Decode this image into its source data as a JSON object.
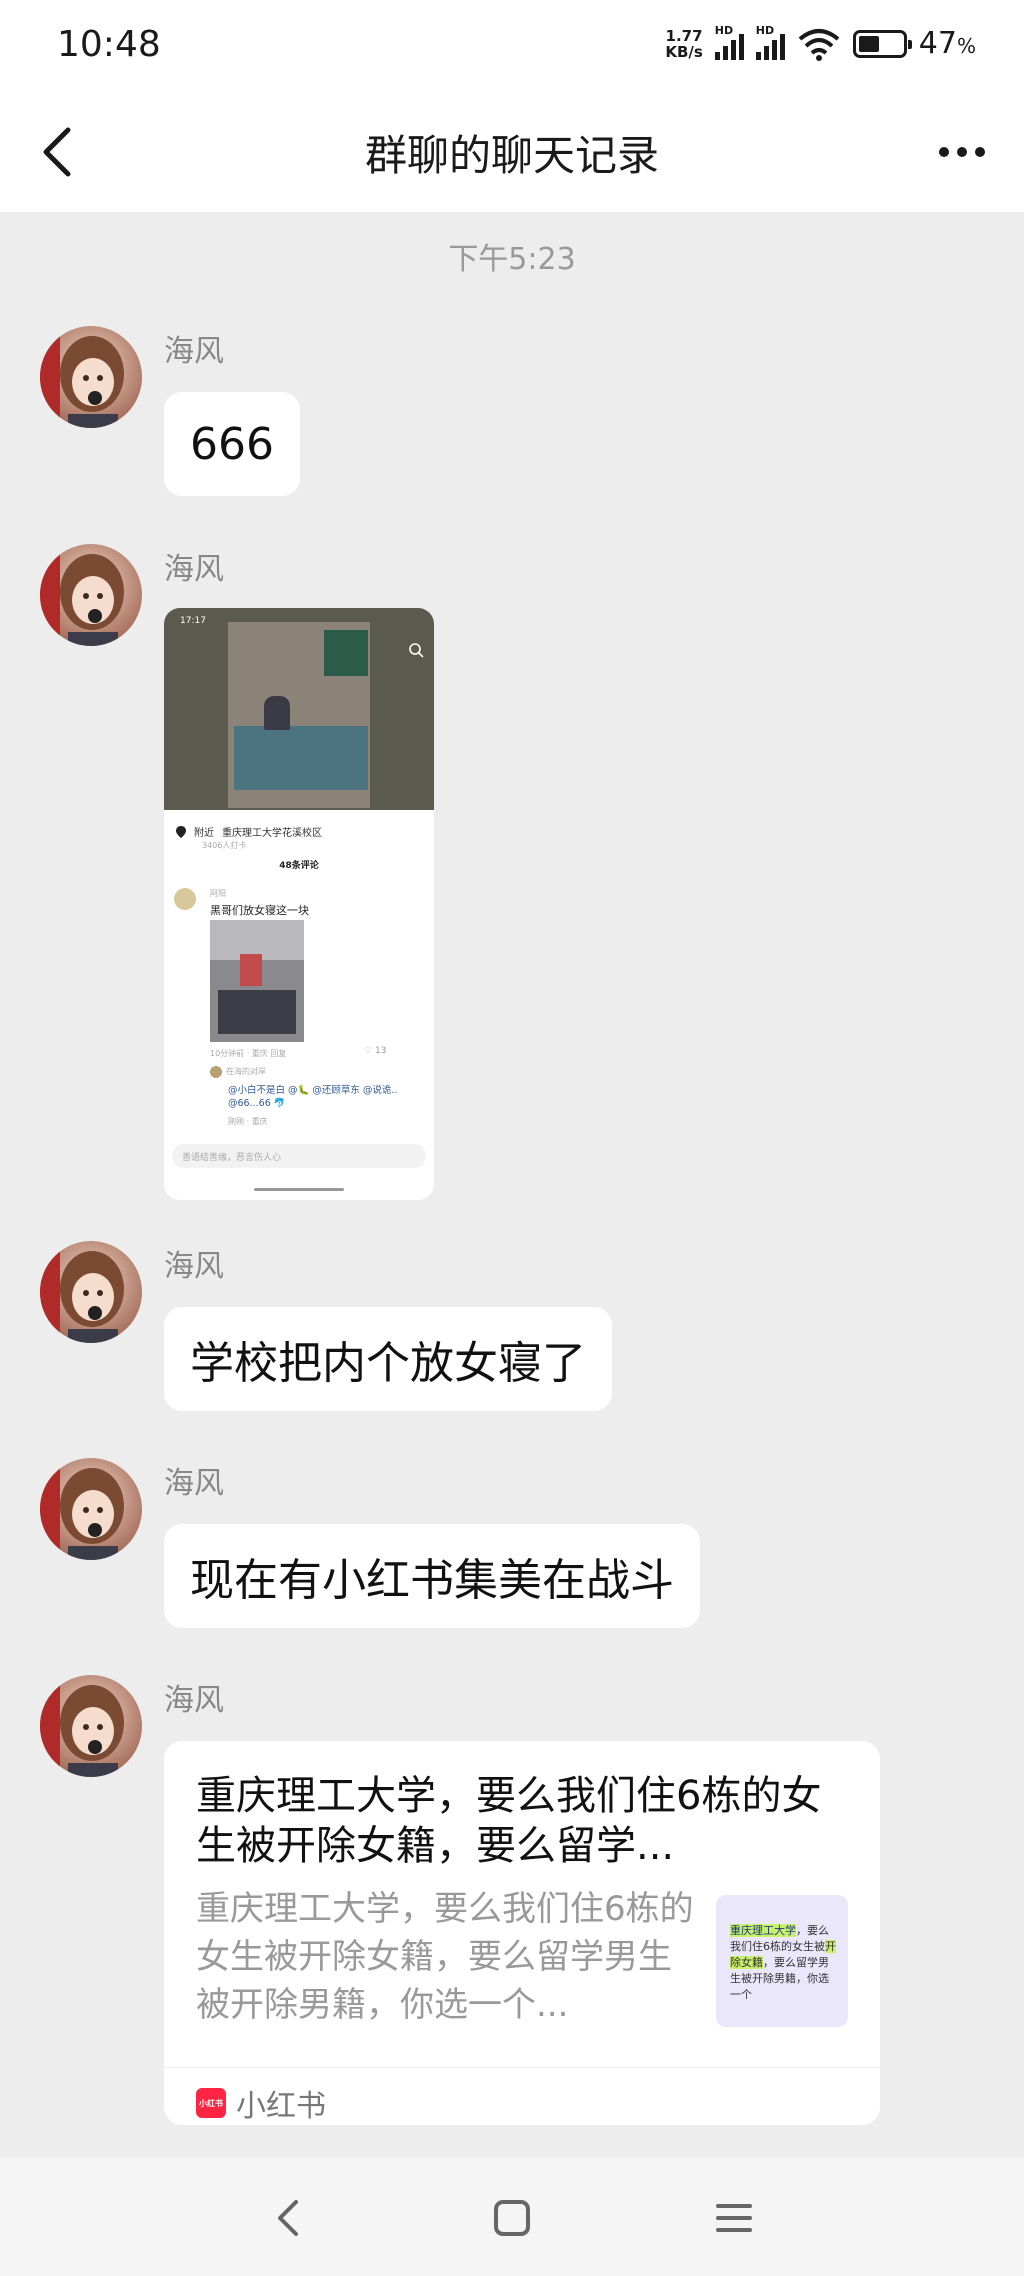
{
  "status_bar": {
    "time": "10:48",
    "net_speed_value": "1.77",
    "net_speed_unit": "KB/s",
    "signal_label_1": "HD",
    "signal_label_2": "HD",
    "battery_level": 0.47,
    "battery_percent": "47",
    "battery_unit": "%"
  },
  "header": {
    "title": "群聊的聊天记录",
    "back_icon": "chevron-left-icon",
    "more_icon": "more-dots-icon"
  },
  "chat": {
    "time_separator": "下午5:23",
    "messages": [
      {
        "sender": "海风",
        "type": "text",
        "text": "666"
      },
      {
        "sender": "海风",
        "type": "image"
      },
      {
        "sender": "海风",
        "type": "text",
        "text": "学校把内个放女寝了"
      },
      {
        "sender": "海风",
        "type": "text",
        "text": "现在有小红书集美在战斗"
      },
      {
        "sender": "海风",
        "type": "link_card"
      }
    ]
  },
  "screenshot": {
    "time": "17:17",
    "location_prefix": "附近",
    "location": "重庆理工大学花溪校区",
    "visitors": "3406人打卡",
    "comments_title": "48条评论",
    "comment_user": "阿阳",
    "comment_text": "黑哥们放女寝这一块",
    "comment_meta": "10分钟前 · 重庆",
    "comment_reply": "回复",
    "comment_likes": "13",
    "reply_user": "在海的对岸",
    "reply_text_1": "@小白不是白 @🐛 @还顾草东 @说诡..",
    "reply_text_2": "@66...66 🐬",
    "reply_meta": "刚刚 · 重庆",
    "input_placeholder": "善语结善缘，恶言伤人心"
  },
  "link_card": {
    "title": "重庆理工大学，要么我们住6栋的女生被开除女籍，要么留学...",
    "description": "重庆理工大学，要么我们住6栋的女生被开除女籍，要么留学男生被开除男籍，你选一个...",
    "thumb_highlight_1": "重庆理工大学",
    "thumb_text_1": "，要么我们住6栋的女生被",
    "thumb_highlight_2": "开除女籍",
    "thumb_text_2": "，要么留学男生被开除男籍，你选一个",
    "logo_text": "小红书",
    "source": "小红书"
  },
  "system_nav": {
    "back_icon": "nav-back-icon",
    "home_icon": "nav-home-icon",
    "menu_icon": "nav-menu-icon"
  }
}
